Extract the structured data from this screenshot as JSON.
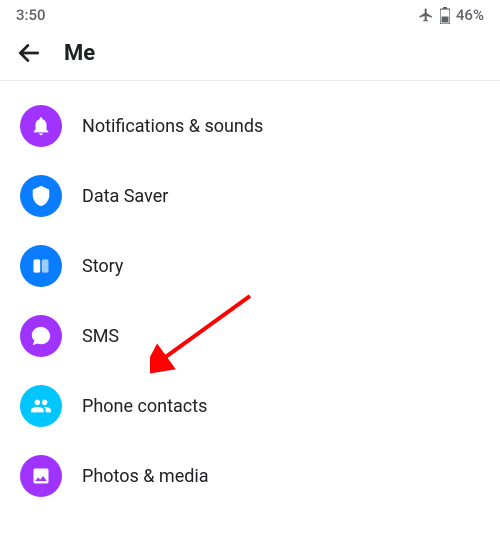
{
  "status": {
    "time": "3:50",
    "battery_percent": "46%"
  },
  "header": {
    "title": "Me"
  },
  "settings": {
    "items": [
      {
        "label": "Notifications & sounds",
        "icon": "bell-icon",
        "color": "purple"
      },
      {
        "label": "Data Saver",
        "icon": "shield-icon",
        "color": "blue"
      },
      {
        "label": "Story",
        "icon": "story-icon",
        "color": "blue"
      },
      {
        "label": "SMS",
        "icon": "chat-icon",
        "color": "purple"
      },
      {
        "label": "Phone contacts",
        "icon": "contacts-icon",
        "color": "cyan"
      },
      {
        "label": "Photos & media",
        "icon": "photo-icon",
        "color": "purple"
      }
    ]
  },
  "annotation": {
    "target": "SMS",
    "color": "#ff0000"
  }
}
